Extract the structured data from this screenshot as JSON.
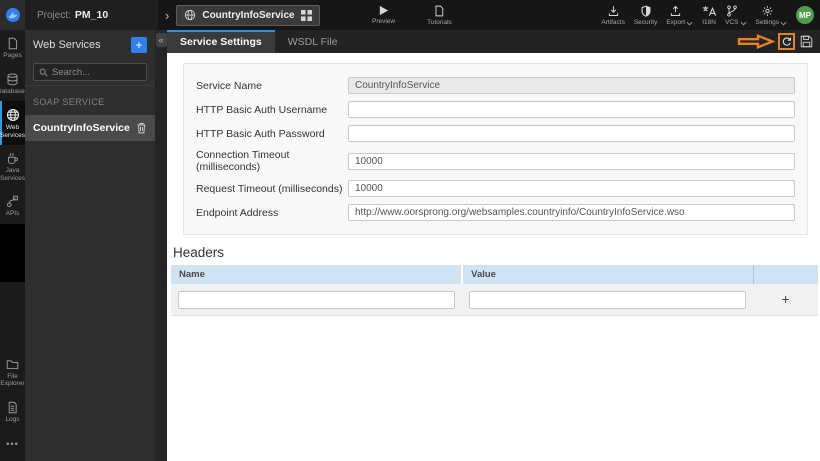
{
  "topbar": {
    "project_label": "Project:",
    "project_name": "PM_10",
    "doc_tab_label": "CountryInfoService",
    "preview_label": "Preview",
    "tutorials_label": "Tutorials",
    "artifacts_label": "Artifacts",
    "security_label": "Security",
    "export_label": "Export",
    "i18n_label": "I18N",
    "vcs_label": "VCS",
    "settings_label": "Settings",
    "avatar_initials": "MP"
  },
  "sidebar": {
    "items": [
      {
        "label": "Pages"
      },
      {
        "label": "Databases"
      },
      {
        "label": "Web Services"
      },
      {
        "label": "Java Services"
      },
      {
        "label": "APIs"
      }
    ],
    "bottom_items": [
      {
        "label": "File Explorer"
      },
      {
        "label": "Logs"
      }
    ],
    "more_glyph": "•••"
  },
  "panel": {
    "title": "Web Services",
    "search_placeholder": "Search...",
    "section_label": "SOAP SERVICE",
    "items": [
      {
        "name": "CountryInfoService",
        "selected": true
      }
    ]
  },
  "icons": {
    "plus": "+",
    "collapse": "«",
    "project_chevron": "›"
  },
  "tabs": [
    {
      "label": "Service Settings",
      "active": true
    },
    {
      "label": "WSDL File",
      "active": false
    }
  ],
  "form": {
    "fields": [
      {
        "label": "Service Name",
        "value": "CountryInfoService",
        "disabled": true
      },
      {
        "label": "HTTP Basic Auth Username",
        "value": ""
      },
      {
        "label": "HTTP Basic Auth Password",
        "value": ""
      },
      {
        "label": "Connection Timeout (milliseconds)",
        "value": "10000"
      },
      {
        "label": "Request Timeout (milliseconds)",
        "value": "10000"
      },
      {
        "label": "Endpoint Address",
        "value": "http://www.oorsprong.org/websamples.countryinfo/CountryInfoService.wso"
      }
    ]
  },
  "headers_section": {
    "title": "Headers",
    "columns": [
      "Name",
      "Value"
    ],
    "add_label": "+",
    "row": {
      "name": "",
      "value": ""
    }
  },
  "colors": {
    "accent_blue": "#2f80ed",
    "tab_active_blue": "#2f8fe0",
    "annotation_orange": "#e8821e",
    "avatar_green": "#4f9e4f",
    "table_header_blue": "#cfe3f2"
  }
}
